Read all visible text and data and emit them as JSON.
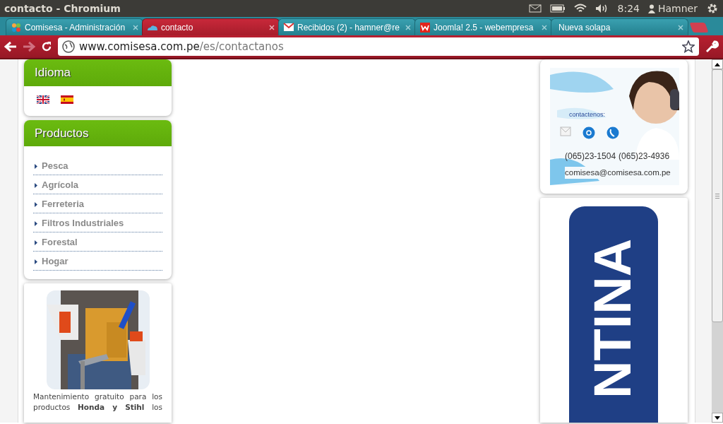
{
  "window": {
    "title": "contacto - Chromium"
  },
  "system_tray": {
    "time": "8:24",
    "user": "Hamner"
  },
  "tabs": [
    {
      "title": "Comisesa - Administración",
      "selected": false,
      "kind": "joomla"
    },
    {
      "title": "contacto",
      "selected": true,
      "kind": "cloud"
    },
    {
      "title": "Recibidos (2) - hamner@re",
      "selected": false,
      "kind": "mail"
    },
    {
      "title": "Joomla! 2.5 - webempresa",
      "selected": false,
      "kind": "webempresa"
    },
    {
      "title": "Nueva solapa",
      "selected": false,
      "kind": "blank"
    }
  ],
  "address_bar": {
    "host": "www.comisesa.com.pe",
    "path": "/es/contactanos"
  },
  "left_modules": [
    {
      "kind": "languages",
      "title": "Idioma"
    },
    {
      "kind": "menu",
      "title": "Productos",
      "items": [
        "Pesca",
        "Agrícola",
        "Ferreteria",
        "Filtros Industriales",
        "Forestal",
        "Hogar"
      ]
    },
    {
      "kind": "promo",
      "text": "Mantenimiento gratuito para los productos **Honda y Stihl** los"
    }
  ],
  "right_modules": [
    {
      "kind": "contact_banner",
      "heading": "contactenos:",
      "phones": [
        "(065)23-1504",
        "(065)23-4936"
      ],
      "email": "comisesa@comisesa.com.pe"
    },
    {
      "kind": "vertical_banner",
      "text": "NTINA"
    }
  ]
}
